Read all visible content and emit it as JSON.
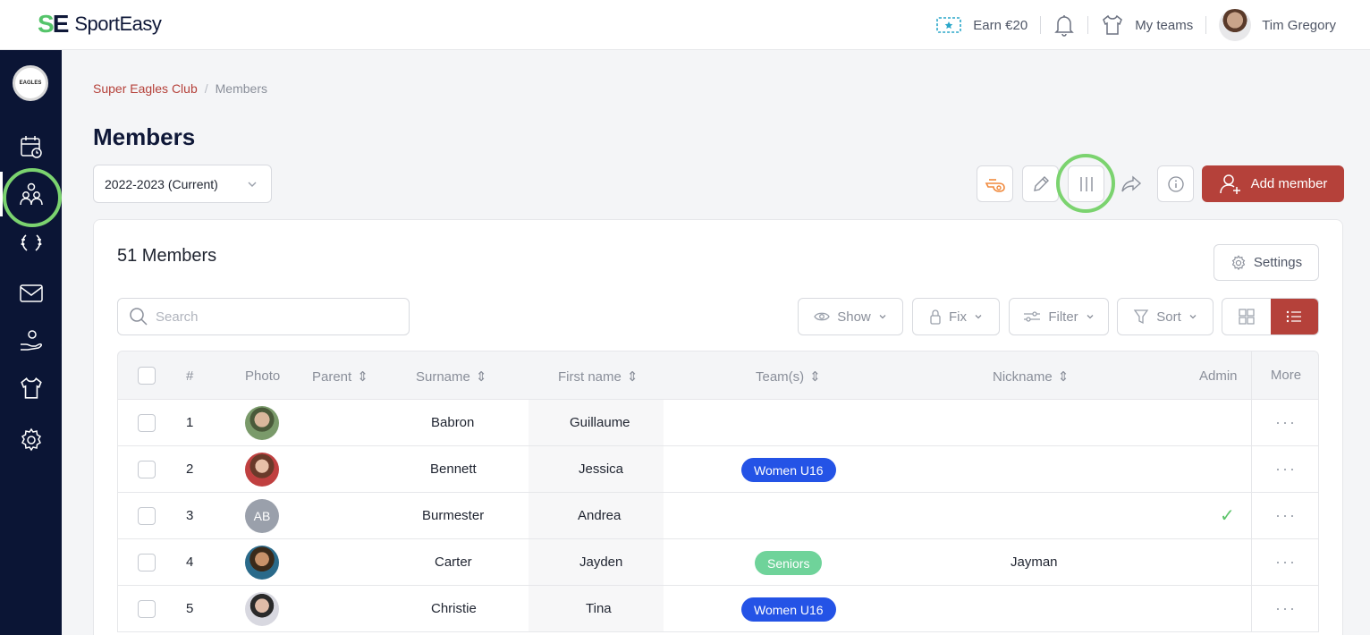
{
  "brand": {
    "name": "SportEasy",
    "logo_mark": "SE"
  },
  "topbar": {
    "earn_label": "Earn €20",
    "my_teams_label": "My teams",
    "user_name": "Tim Gregory"
  },
  "sidebar": {
    "club_badge_text": "EAGLES",
    "items": [
      {
        "icon": "calendar-icon"
      },
      {
        "icon": "members-icon",
        "active": true
      },
      {
        "icon": "laurel-icon"
      },
      {
        "icon": "mail-icon"
      },
      {
        "icon": "hand-heart-icon"
      },
      {
        "icon": "jersey-icon"
      },
      {
        "icon": "gear-icon"
      }
    ]
  },
  "breadcrumb": {
    "club": "Super Eagles Club",
    "current": "Members"
  },
  "page": {
    "title": "Members",
    "season": "2022-2023 (Current)",
    "add_member_label": "Add member"
  },
  "card": {
    "count_title": "51 Members",
    "settings_label": "Settings",
    "search_placeholder": "Search",
    "show_label": "Show",
    "fix_label": "Fix",
    "filter_label": "Filter",
    "sort_label": "Sort"
  },
  "table": {
    "headers": {
      "num": "#",
      "photo": "Photo",
      "parent": "Parent",
      "surname": "Surname",
      "first_name": "First name",
      "teams": "Team(s)",
      "nickname": "Nickname",
      "admin": "Admin",
      "more": "More"
    },
    "rows": [
      {
        "num": "1",
        "photo": "photo",
        "surname": "Babron",
        "first_name": "Guillaume",
        "team": "",
        "nickname": "",
        "admin": false
      },
      {
        "num": "2",
        "photo": "photo",
        "surname": "Bennett",
        "first_name": "Jessica",
        "team": "Women U16",
        "nickname": "",
        "admin": false
      },
      {
        "num": "3",
        "photo": "AB",
        "surname": "Burmester",
        "first_name": "Andrea",
        "team": "",
        "nickname": "",
        "admin": true
      },
      {
        "num": "4",
        "photo": "photo",
        "surname": "Carter",
        "first_name": "Jayden",
        "team": "Seniors",
        "nickname": "Jayman",
        "admin": false
      },
      {
        "num": "5",
        "photo": "photo",
        "surname": "Christie",
        "first_name": "Tina",
        "team": "Women U16",
        "nickname": "",
        "admin": false
      }
    ],
    "more_glyph": "···",
    "admin_check_glyph": "✓"
  },
  "colors": {
    "brand_green": "#55c46a",
    "navy": "#0b1535",
    "accent_red": "#b5413a",
    "badge_blue": "#2453e6",
    "badge_green": "#6fd39a",
    "highlight_green": "#7bd36f"
  }
}
